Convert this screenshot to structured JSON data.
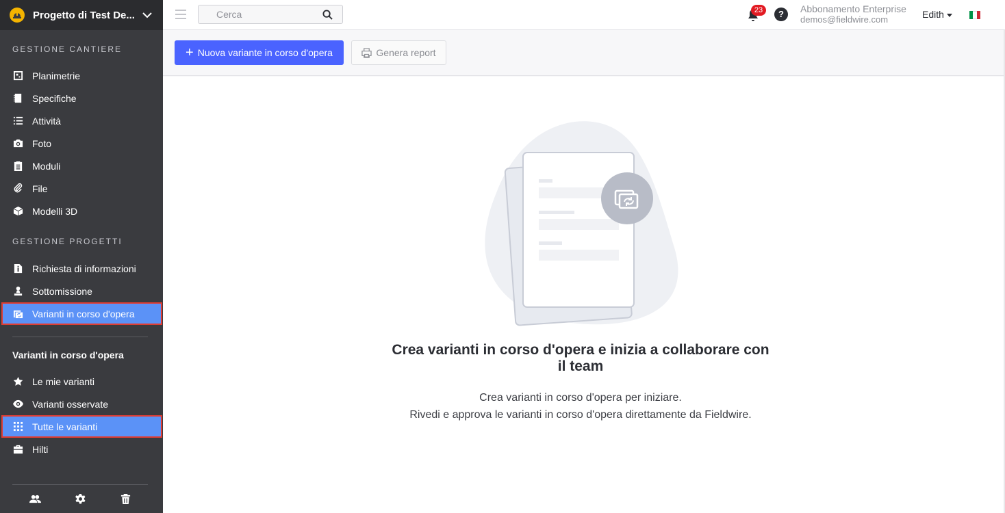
{
  "project": {
    "name": "Progetto di Test De...",
    "logo_icon": "helmet-icon"
  },
  "sidebar": {
    "section1_title": "GESTIONE CANTIERE",
    "section1_items": [
      {
        "label": "Planimetrie",
        "icon": "floorplan-icon"
      },
      {
        "label": "Specifiche",
        "icon": "book-icon"
      },
      {
        "label": "Attività",
        "icon": "list-icon"
      },
      {
        "label": "Foto",
        "icon": "camera-icon"
      },
      {
        "label": "Moduli",
        "icon": "clipboard-icon"
      },
      {
        "label": "File",
        "icon": "paperclip-icon"
      },
      {
        "label": "Modelli 3D",
        "icon": "cube-icon"
      }
    ],
    "section2_title": "GESTIONE PROGETTI",
    "section2_items": [
      {
        "label": "Richiesta di informazioni",
        "icon": "info-file-icon"
      },
      {
        "label": "Sottomissione",
        "icon": "stamp-icon"
      },
      {
        "label": "Varianti in corso d'opera",
        "icon": "change-order-icon",
        "active": true
      }
    ],
    "subnav_title": "Varianti in corso d'opera",
    "subnav_items": [
      {
        "label": "Le mie varianti",
        "icon": "star-icon"
      },
      {
        "label": "Varianti osservate",
        "icon": "eye-icon"
      },
      {
        "label": "Tutte le varianti",
        "icon": "grid-icon",
        "active": true
      },
      {
        "label": "Hilti",
        "icon": "toolbox-icon"
      }
    ],
    "footer_icons": [
      "people-icon",
      "gear-icon",
      "trash-icon"
    ]
  },
  "topbar": {
    "search_placeholder": "Cerca",
    "notification_count": "23",
    "help_label": "?",
    "plan_name": "Abbonamento Enterprise",
    "email": "demos@fieldwire.com",
    "user_name": "Edith",
    "flag_colors": [
      "#009246",
      "#ffffff",
      "#ce2b37"
    ]
  },
  "toolbar": {
    "new_button": "Nuova variante in corso d'opera",
    "report_button": "Genera report"
  },
  "empty_state": {
    "title": "Crea varianti in corso d'opera e inizia a collaborare con il team",
    "line1": "Crea varianti in corso d'opera per iniziare.",
    "line2": "Rivedi e approva le varianti in corso d'opera direttamente da Fieldwire."
  },
  "colors": {
    "accent": "#4a63ff",
    "active_nav": "#5b92f7",
    "highlight_border": "#e03c31",
    "sidebar_bg": "#3a3b3f"
  }
}
